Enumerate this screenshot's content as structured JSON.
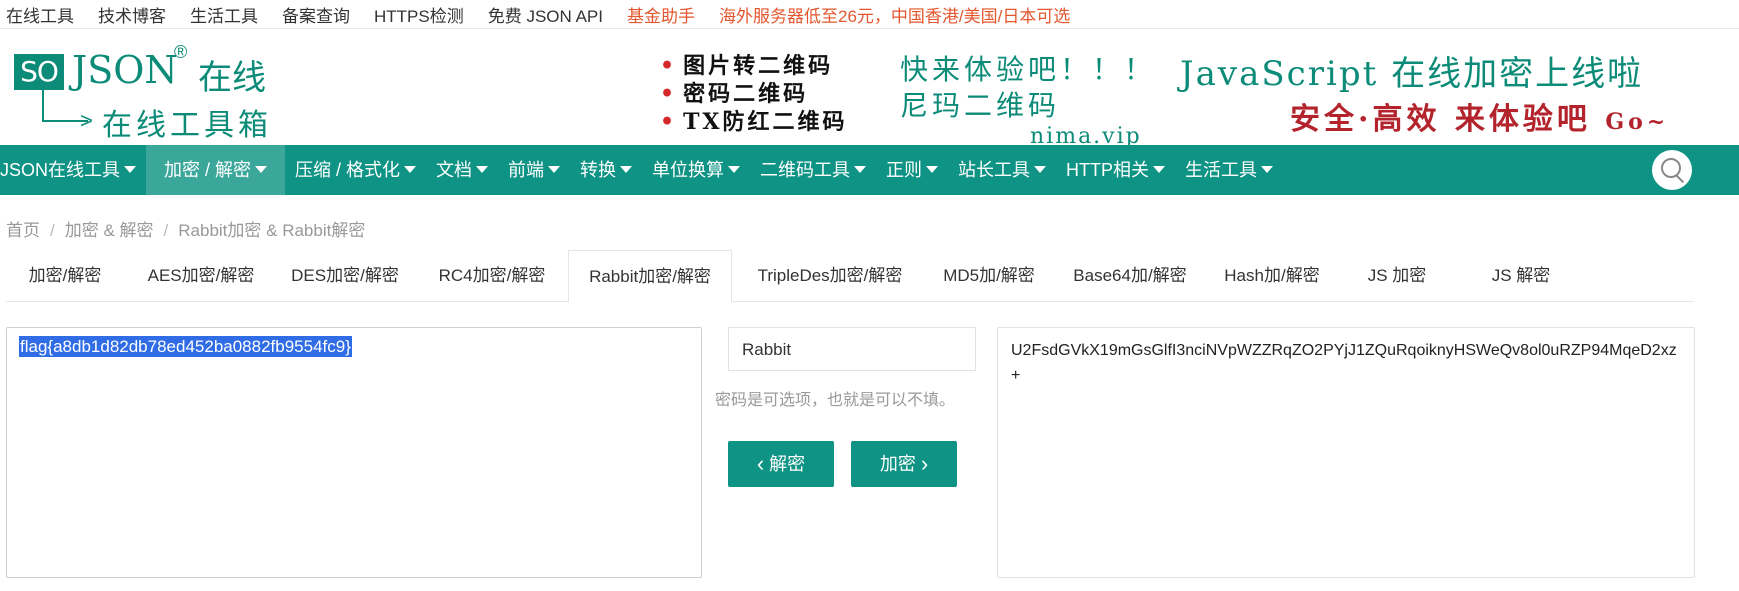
{
  "topbar": {
    "links": [
      "在线工具",
      "技术博客",
      "生活工具",
      "备案查询",
      "HTTPS检测",
      "免费 JSON API"
    ],
    "promo": [
      "基金助手",
      "海外服务器低至26元，中国香港/美国/日本可选"
    ]
  },
  "logo": {
    "so": "SO",
    "json": "JSON",
    "reg": "®",
    "zaixian": "在线",
    "tools": "在线工具箱"
  },
  "banner": {
    "lines": [
      "图片转二维码",
      "密码二维码",
      "TX防红二维码"
    ],
    "green1": "快来体验吧！！！",
    "green2": "尼玛二维码",
    "nima": "nima.vip",
    "js": "JavaScript 在线加密上线啦",
    "red": "安全·高效 来体验吧",
    "go": "Go~"
  },
  "nav": {
    "items": [
      "JSON在线工具",
      "加密 / 解密",
      "压缩 / 格式化",
      "文档",
      "前端",
      "转换",
      "单位换算",
      "二维码工具",
      "正则",
      "站长工具",
      "HTTP相关",
      "生活工具"
    ],
    "active_index": 1
  },
  "breadcrumb": [
    "首页",
    "加密 & 解密",
    "Rabbit加密 & Rabbit解密"
  ],
  "tabs": {
    "items": [
      "加密/解密",
      "AES加密/解密",
      "DES加密/解密",
      "RC4加密/解密",
      "Rabbit加密/解密",
      "TripleDes加密/解密",
      "MD5加/解密",
      "Base64加/解密",
      "Hash加/解密",
      "JS 加密",
      "JS 解密"
    ],
    "active_index": 4
  },
  "input": {
    "text": "flag{a8db1d82db78ed452ba0882fb9554fc9}"
  },
  "password": {
    "value": "Rabbit",
    "hint": "密码是可选项，也就是可以不填。"
  },
  "buttons": {
    "decrypt": "解密",
    "encrypt": "加密"
  },
  "output": {
    "text": "U2FsdGVkX19mGsGlfI3nciNVpWZZRqZO2PYjJ1ZQuRqoiknyHSWeQv8ol0uRZP94MqeD2xz+"
  },
  "colors": {
    "brand": "#0e9384",
    "promo": "#e4572e",
    "selection": "#2f6ce6"
  }
}
